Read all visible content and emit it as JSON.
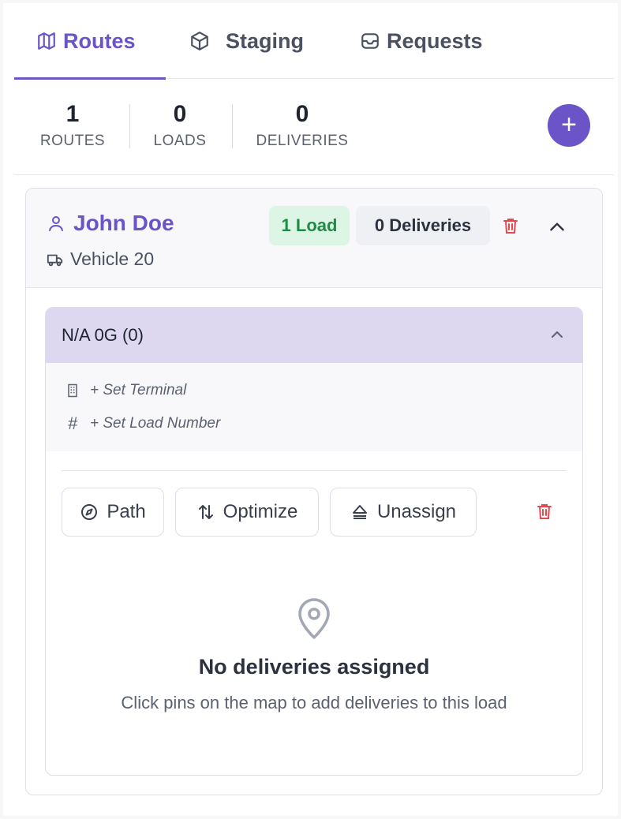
{
  "tabs": [
    {
      "label": "Routes",
      "icon": "map-icon",
      "active": true
    },
    {
      "label": "Staging",
      "icon": "box-icon",
      "active": false
    },
    {
      "label": "Requests",
      "icon": "inbox-icon",
      "active": false
    }
  ],
  "stats": {
    "routes": {
      "value": "1",
      "label": "ROUTES"
    },
    "loads": {
      "value": "0",
      "label": "LOADS"
    },
    "deliveries": {
      "value": "0",
      "label": "DELIVERIES"
    },
    "add_label": "+"
  },
  "route": {
    "driver": "John Doe",
    "vehicle": "Vehicle 20",
    "load_badge": "1 Load",
    "deliveries_badge": "0 Deliveries"
  },
  "load": {
    "title": "N/A 0G (0)",
    "set_terminal": "+ Set Terminal",
    "set_load_number": "+ Set Load Number",
    "hash_symbol": "#",
    "actions": {
      "path": "Path",
      "optimize": "Optimize",
      "unassign": "Unassign"
    },
    "empty_title": "No deliveries assigned",
    "empty_sub": "Click pins on the map to add deliveries to this load"
  },
  "colors": {
    "accent": "#6a54c8",
    "danger": "#e5484d",
    "success_bg": "#dcf5e4",
    "success_text": "#1f8a45",
    "load_header_bg": "#ddd8f0"
  }
}
